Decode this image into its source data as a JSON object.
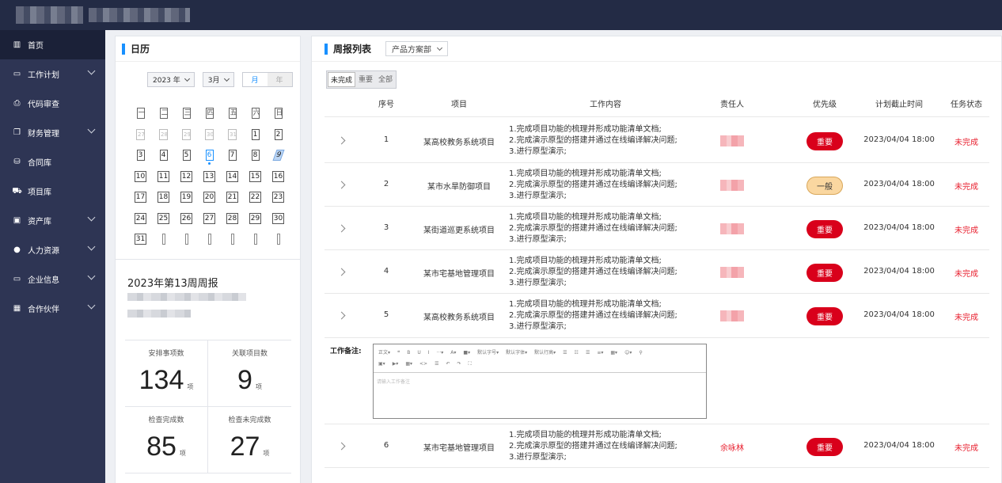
{
  "sidebar": {
    "items": [
      {
        "label": "首页",
        "icon": "building-icon",
        "glyph": "▥",
        "active": true,
        "expandable": false
      },
      {
        "label": "工作计划",
        "icon": "folder-icon",
        "glyph": "▭",
        "active": false,
        "expandable": true
      },
      {
        "label": "代码审查",
        "icon": "printer-icon",
        "glyph": "⎙",
        "active": false,
        "expandable": false
      },
      {
        "label": "财务管理",
        "icon": "copy-icon",
        "glyph": "❐",
        "active": false,
        "expandable": true
      },
      {
        "label": "合同库",
        "icon": "database-icon",
        "glyph": "⛁",
        "active": false,
        "expandable": false
      },
      {
        "label": "项目库",
        "icon": "truck-icon",
        "glyph": "⛟",
        "active": false,
        "expandable": false
      },
      {
        "label": "资产库",
        "icon": "chart-box-icon",
        "glyph": "▣",
        "active": false,
        "expandable": true
      },
      {
        "label": "人力资源",
        "icon": "user-icon",
        "glyph": "●",
        "active": false,
        "expandable": true
      },
      {
        "label": "企业信息",
        "icon": "folder-icon",
        "glyph": "▭",
        "active": false,
        "expandable": true
      },
      {
        "label": "合作伙伴",
        "icon": "grid-icon",
        "glyph": "▦",
        "active": false,
        "expandable": true
      }
    ]
  },
  "calendar": {
    "title": "日历",
    "year": "2023 年",
    "month": "3月",
    "view_month": "月",
    "view_year": "年",
    "weeks": [
      [
        {
          "t": "一",
          "k": "head"
        },
        {
          "t": "二",
          "k": "head"
        },
        {
          "t": "三",
          "k": "head"
        },
        {
          "t": "四",
          "k": "head"
        },
        {
          "t": "五",
          "k": "head"
        },
        {
          "t": "六",
          "k": "head"
        },
        {
          "t": "日",
          "k": "head"
        }
      ],
      [
        {
          "t": "27",
          "k": "muted"
        },
        {
          "t": "28",
          "k": "muted"
        },
        {
          "t": "29",
          "k": "muted"
        },
        {
          "t": "30",
          "k": "muted"
        },
        {
          "t": "31",
          "k": "muted"
        },
        {
          "t": "1",
          "k": ""
        },
        {
          "t": "2",
          "k": ""
        }
      ],
      [
        {
          "t": "3",
          "k": ""
        },
        {
          "t": "4",
          "k": ""
        },
        {
          "t": "5",
          "k": ""
        },
        {
          "t": "6",
          "k": "today"
        },
        {
          "t": "7",
          "k": ""
        },
        {
          "t": "8",
          "k": ""
        },
        {
          "t": "9",
          "k": "sel-day"
        }
      ],
      [
        {
          "t": "10",
          "k": ""
        },
        {
          "t": "11",
          "k": ""
        },
        {
          "t": "12",
          "k": ""
        },
        {
          "t": "13",
          "k": ""
        },
        {
          "t": "14",
          "k": ""
        },
        {
          "t": "15",
          "k": ""
        },
        {
          "t": "16",
          "k": ""
        }
      ],
      [
        {
          "t": "17",
          "k": ""
        },
        {
          "t": "18",
          "k": ""
        },
        {
          "t": "19",
          "k": ""
        },
        {
          "t": "20",
          "k": ""
        },
        {
          "t": "21",
          "k": ""
        },
        {
          "t": "22",
          "k": ""
        },
        {
          "t": "23",
          "k": ""
        }
      ],
      [
        {
          "t": "24",
          "k": ""
        },
        {
          "t": "25",
          "k": ""
        },
        {
          "t": "26",
          "k": ""
        },
        {
          "t": "27",
          "k": ""
        },
        {
          "t": "28",
          "k": ""
        },
        {
          "t": "29",
          "k": ""
        },
        {
          "t": "30",
          "k": ""
        }
      ],
      [
        {
          "t": "31",
          "k": ""
        },
        {
          "t": "",
          "k": "thin"
        },
        {
          "t": "",
          "k": "thin"
        },
        {
          "t": "",
          "k": "thin"
        },
        {
          "t": "",
          "k": "thin"
        },
        {
          "t": "",
          "k": "thin"
        },
        {
          "t": "",
          "k": "thin"
        }
      ]
    ]
  },
  "weekly": {
    "title": "2023年第13周周报",
    "stats": [
      {
        "label": "安排事项数",
        "value": "134",
        "unit": "项"
      },
      {
        "label": "关联项目数",
        "value": "9",
        "unit": "项"
      },
      {
        "label": "检查完成数",
        "value": "85",
        "unit": "项"
      },
      {
        "label": "检查未完成数",
        "value": "27",
        "unit": "项"
      }
    ]
  },
  "list": {
    "title": "周报列表",
    "department": "产品方案部",
    "filters": [
      "未完成",
      "重要",
      "全部"
    ],
    "active_filter": "未完成",
    "columns": {
      "index": "序号",
      "project": "项目",
      "content": "工作内容",
      "owner": "责任人",
      "priority": "优先级",
      "deadline": "计划截止时间",
      "status": "任务状态"
    },
    "rows": [
      {
        "index": "1",
        "project": "某高校教务系统项目",
        "content": [
          "1.完成项目功能的梳理并形成功能清单文档;",
          "2.完成演示原型的搭建并通过在线编译解决问题;",
          "3.进行原型演示;"
        ],
        "owner": "",
        "priority": "重要",
        "priority_level": "major",
        "deadline": "2023/04/04 18:00",
        "status": "未完成"
      },
      {
        "index": "2",
        "project": "某市水旱防御项目",
        "content": [
          "1.完成项目功能的梳理并形成功能清单文档;",
          "2.完成演示原型的搭建并通过在线编译解决问题;",
          "3.进行原型演示;"
        ],
        "owner": "",
        "priority": "一般",
        "priority_level": "normal",
        "deadline": "2023/04/04 18:00",
        "status": "未完成"
      },
      {
        "index": "3",
        "project": "某街道巡更系统项目",
        "content": [
          "1.完成项目功能的梳理并形成功能清单文档;",
          "2.完成演示原型的搭建并通过在线编译解决问题;",
          "3.进行原型演示;"
        ],
        "owner": "",
        "priority": "重要",
        "priority_level": "major",
        "deadline": "2023/04/04 18:00",
        "status": "未完成"
      },
      {
        "index": "4",
        "project": "某市宅基地管理项目",
        "content": [
          "1.完成项目功能的梳理并形成功能清单文档;",
          "2.完成演示原型的搭建并通过在线编译解决问题;",
          "3.进行原型演示;"
        ],
        "owner": "",
        "priority": "重要",
        "priority_level": "major",
        "deadline": "2023/04/04 18:00",
        "status": "未完成"
      },
      {
        "index": "5",
        "project": "某高校教务系统项目",
        "content": [
          "1.完成项目功能的梳理并形成功能清单文档;",
          "2.完成演示原型的搭建并通过在线编译解决问题;",
          "3.进行原型演示;"
        ],
        "owner": "",
        "priority": "重要",
        "priority_level": "major",
        "deadline": "2023/04/04 18:00",
        "status": "未完成"
      },
      {
        "index": "6",
        "project": "某市宅基地管理项目",
        "content": [
          "1.完成项目功能的梳理并形成功能清单文档;",
          "2.完成演示原型的搭建并通过在线编译解决问题;",
          "3.进行原型演示;"
        ],
        "owner": "余咏林",
        "priority": "重要",
        "priority_level": "major",
        "deadline": "2023/04/04 18:00",
        "status": "未完成"
      }
    ],
    "remark": {
      "label": "工作备注:",
      "toolbar_row1": [
        "正文▾",
        "❝",
        "B",
        "U",
        "I",
        "···▾",
        "A▾",
        "■▾",
        "默认字号▾",
        "默认字体▾",
        "默认行高▾",
        "☰",
        "☷",
        "☰",
        "≡▾",
        "▦▾",
        "☺▾",
        "⚲"
      ],
      "toolbar_row2": [
        "▣▾",
        "▶▾",
        "▦▾",
        "<>",
        "☰",
        "↶",
        "↷",
        "⛶"
      ],
      "placeholder": "请输入工作备注"
    }
  }
}
